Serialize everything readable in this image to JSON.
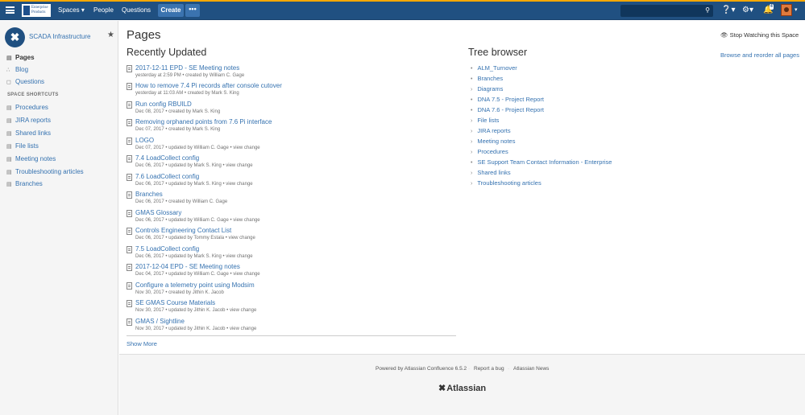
{
  "header": {
    "logo_text": "Enterprise Products",
    "nav": [
      "Spaces ▾",
      "People",
      "Questions"
    ],
    "create_label": "Create",
    "more_label": "•••",
    "search_placeholder": "",
    "notification_count": "4",
    "colors": {
      "topbar": "#205081",
      "accent": "#f7a800",
      "link": "#3572b0"
    }
  },
  "sidebar": {
    "space_name": "SCADA Infrastructure",
    "items": [
      {
        "label": "Pages",
        "icon": "pages-icon"
      },
      {
        "label": "Blog",
        "icon": "blog-icon"
      },
      {
        "label": "Questions",
        "icon": "questions-icon"
      }
    ],
    "shortcuts_header": "SPACE SHORTCUTS",
    "shortcuts": [
      "Procedures",
      "JIRA reports",
      "Shared links",
      "File lists",
      "Meeting notes",
      "Troubleshooting articles",
      "Branches"
    ]
  },
  "main": {
    "title": "Pages",
    "stop_watching": "Stop Watching this Space",
    "browse": "Browse and reorder all pages",
    "recently_updated_title": "Recently Updated",
    "recent": [
      {
        "title": "2017-12-11 EPD - SE Meeting notes",
        "meta": "yesterday at 2:59 PM • created by William C. Gage"
      },
      {
        "title": "How to remove 7.4 Pi records after console cutover",
        "meta": "yesterday at 11:03 AM • created by Mark S. King"
      },
      {
        "title": "Run config RBUILD",
        "meta": "Dec 08, 2017 • created by Mark S. King"
      },
      {
        "title": "Removing orphaned points from 7.6 Pi interface",
        "meta": "Dec 07, 2017 • created by Mark S. King"
      },
      {
        "title": "LOGO",
        "meta": "Dec 07, 2017 • updated by William C. Gage • view change"
      },
      {
        "title": "7.4 LoadCollect config",
        "meta": "Dec 06, 2017 • updated by Mark S. King • view change"
      },
      {
        "title": "7.6 LoadCollect config",
        "meta": "Dec 06, 2017 • updated by Mark S. King • view change"
      },
      {
        "title": "Branches",
        "meta": "Dec 06, 2017 • created by William C. Gage"
      },
      {
        "title": "GMAS Glossary",
        "meta": "Dec 06, 2017 • updated by William C. Gage • view change"
      },
      {
        "title": "Controls Engineering Contact List",
        "meta": "Dec 06, 2017 • updated by Tommy Estala • view change"
      },
      {
        "title": "7.5 LoadCollect config",
        "meta": "Dec 06, 2017 • updated by Mark S. King • view change"
      },
      {
        "title": "2017-12-04 EPD - SE Meeting notes",
        "meta": "Dec 04, 2017 • updated by William C. Gage • view change"
      },
      {
        "title": "Configure a telemetry point using Modsim",
        "meta": "Nov 30, 2017 • created by Jithin K. Jacob"
      },
      {
        "title": "SE GMAS Course Materials",
        "meta": "Nov 30, 2017 • updated by Jithin K. Jacob • view change"
      },
      {
        "title": "GMAS / Sightline",
        "meta": "Nov 30, 2017 • updated by Jithin K. Jacob • view change"
      }
    ],
    "show_more": "Show More",
    "tree_title": "Tree browser",
    "tree": [
      {
        "label": "ALM_Turnover",
        "bullet": "•"
      },
      {
        "label": "Branches",
        "bullet": "•"
      },
      {
        "label": "Diagrams",
        "bullet": "›"
      },
      {
        "label": "DNA 7.5 - Project Report",
        "bullet": "•"
      },
      {
        "label": "DNA 7.6 - Project Report",
        "bullet": "•"
      },
      {
        "label": "File lists",
        "bullet": "›"
      },
      {
        "label": "JIRA reports",
        "bullet": "›"
      },
      {
        "label": "Meeting notes",
        "bullet": "›"
      },
      {
        "label": "Procedures",
        "bullet": "›"
      },
      {
        "label": "SE Support Team Contact Information - Enterprise",
        "bullet": "•"
      },
      {
        "label": "Shared links",
        "bullet": "›"
      },
      {
        "label": "Troubleshooting articles",
        "bullet": "›"
      }
    ]
  },
  "footer": {
    "powered": "Powered by Atlassian Confluence 6.5.2",
    "bug": "Report a bug",
    "news": "Atlassian News",
    "brand": "Atlassian"
  }
}
